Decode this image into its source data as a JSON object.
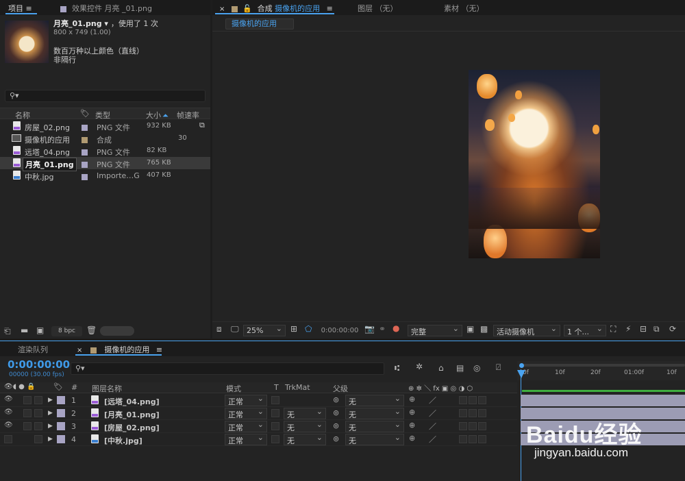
{
  "project_panel": {
    "tab_project": "项目",
    "tab_effects": "效果控件 月亮 _01.png",
    "selected_name": "月亮_01.png ▾",
    "used_times": "，使用了 1 次",
    "dimensions": "800 x 749 (1.00)",
    "colors": "数百万种以上颜色（直线）",
    "interlace": "非隔行",
    "search_placeholder": "",
    "columns": {
      "name": "名称",
      "type": "类型",
      "size": "大小",
      "fps": "帧速率"
    },
    "items": [
      {
        "name": "房屋_02.png",
        "type": "PNG 文件",
        "size": "932 KB",
        "fps": "",
        "icon": "png"
      },
      {
        "name": "摄像机的应用",
        "type": "合成",
        "size": "",
        "fps": "30",
        "icon": "comp"
      },
      {
        "name": "远塔_04.png",
        "type": "PNG 文件",
        "size": "82 KB",
        "fps": "",
        "icon": "png"
      },
      {
        "name": "月亮_01.png",
        "type": "PNG 文件",
        "size": "765 KB",
        "fps": "",
        "icon": "png"
      },
      {
        "name": "中秋.jpg",
        "type": "Importe…G",
        "size": "407 KB",
        "fps": "",
        "icon": "jpg"
      }
    ],
    "bpc": "8 bpc"
  },
  "comp_panel": {
    "tab_comp_prefix": "合成",
    "tab_comp_name": "摄像机的应用",
    "tab_layer": "图层 （无）",
    "tab_footage": "素材 （无）",
    "breadcrumb": "摄像机的应用",
    "zoom": "25%",
    "timecode": "0:00:00:00",
    "resolution": "完整",
    "camera": "活动摄像机",
    "views": "1 个..."
  },
  "timeline": {
    "tab_render": "渲染队列",
    "tab_comp": "摄像机的应用",
    "current_time": "0:00:00:00",
    "frames_fps": "00000 (30.00 fps)",
    "columns": {
      "num": "#",
      "layer_name": "图层名称",
      "mode": "模式",
      "t": "T",
      "trkmat": "TrkMat",
      "parent": "父级"
    },
    "ruler": [
      "0f",
      "10f",
      "20f",
      "01:00f",
      "10f"
    ],
    "layers": [
      {
        "num": "1",
        "name": "[远塔_04.png]",
        "mode": "正常",
        "trkmat": "",
        "parent": "无",
        "icon": "png"
      },
      {
        "num": "2",
        "name": "[月亮_01.png]",
        "mode": "正常",
        "trkmat": "无",
        "parent": "无",
        "icon": "png"
      },
      {
        "num": "3",
        "name": "[房屋_02.png]",
        "mode": "正常",
        "trkmat": "无",
        "parent": "无",
        "icon": "png"
      },
      {
        "num": "4",
        "name": "[中秋.jpg]",
        "mode": "正常",
        "trkmat": "无",
        "parent": "无",
        "icon": "jpg"
      }
    ]
  },
  "watermark": {
    "logo": "Baidu经验",
    "url": "jingyan.baidu.com"
  },
  "colors": {
    "accent": "#4aa3f0",
    "timecode": "#3f9ae8",
    "label_purple": "#a8a4c4"
  }
}
